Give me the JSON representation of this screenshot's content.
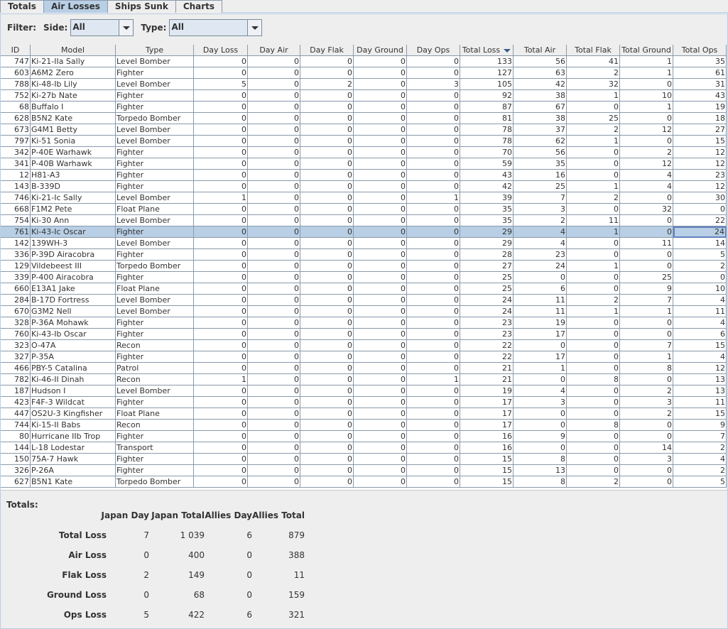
{
  "tabs": [
    "Totals",
    "Air Losses",
    "Ships Sunk",
    "Charts"
  ],
  "active_tab": 1,
  "filter": {
    "label": "Filter:",
    "side_label": "Side:",
    "side_value": "All",
    "type_label": "Type:",
    "type_value": "All"
  },
  "table": {
    "columns": [
      "ID",
      "Model",
      "Type",
      "Day Loss",
      "Day Air",
      "Day Flak",
      "Day Ground",
      "Day Ops",
      "Total Loss",
      "Total Air",
      "Total Flak",
      "Total Ground",
      "Total Ops"
    ],
    "sort_column": "Total Loss",
    "sort_direction": "descending",
    "selected_row": 15,
    "rows": [
      [
        "747",
        "Ki-21-IIa Sally",
        "Level Bomber",
        "0",
        "0",
        "0",
        "0",
        "0",
        "133",
        "56",
        "41",
        "1",
        "35"
      ],
      [
        "603",
        "A6M2 Zero",
        "Fighter",
        "0",
        "0",
        "0",
        "0",
        "0",
        "127",
        "63",
        "2",
        "1",
        "61"
      ],
      [
        "788",
        "Ki-48-Ib Lily",
        "Level Bomber",
        "5",
        "0",
        "2",
        "0",
        "3",
        "105",
        "42",
        "32",
        "0",
        "31"
      ],
      [
        "752",
        "Ki-27b Nate",
        "Fighter",
        "0",
        "0",
        "0",
        "0",
        "0",
        "92",
        "38",
        "1",
        "10",
        "43"
      ],
      [
        "68",
        "Buffalo I",
        "Fighter",
        "0",
        "0",
        "0",
        "0",
        "0",
        "87",
        "67",
        "0",
        "1",
        "19"
      ],
      [
        "628",
        "B5N2 Kate",
        "Torpedo Bomber",
        "0",
        "0",
        "0",
        "0",
        "0",
        "81",
        "38",
        "25",
        "0",
        "18"
      ],
      [
        "673",
        "G4M1 Betty",
        "Level Bomber",
        "0",
        "0",
        "0",
        "0",
        "0",
        "78",
        "37",
        "2",
        "12",
        "27"
      ],
      [
        "797",
        "Ki-51 Sonia",
        "Level Bomber",
        "0",
        "0",
        "0",
        "0",
        "0",
        "78",
        "62",
        "1",
        "0",
        "15"
      ],
      [
        "342",
        "P-40E Warhawk",
        "Fighter",
        "0",
        "0",
        "0",
        "0",
        "0",
        "70",
        "56",
        "0",
        "2",
        "12"
      ],
      [
        "341",
        "P-40B Warhawk",
        "Fighter",
        "0",
        "0",
        "0",
        "0",
        "0",
        "59",
        "35",
        "0",
        "12",
        "12"
      ],
      [
        "12",
        "H81-A3",
        "Fighter",
        "0",
        "0",
        "0",
        "0",
        "0",
        "43",
        "16",
        "0",
        "4",
        "23"
      ],
      [
        "143",
        "B-339D",
        "Fighter",
        "0",
        "0",
        "0",
        "0",
        "0",
        "42",
        "25",
        "1",
        "4",
        "12"
      ],
      [
        "746",
        "Ki-21-Ic Sally",
        "Level Bomber",
        "1",
        "0",
        "0",
        "0",
        "1",
        "39",
        "7",
        "2",
        "0",
        "30"
      ],
      [
        "668",
        "F1M2 Pete",
        "Float Plane",
        "0",
        "0",
        "0",
        "0",
        "0",
        "35",
        "3",
        "0",
        "32",
        "0"
      ],
      [
        "754",
        "Ki-30 Ann",
        "Level Bomber",
        "0",
        "0",
        "0",
        "0",
        "0",
        "35",
        "2",
        "11",
        "0",
        "22"
      ],
      [
        "761",
        "Ki-43-Ic Oscar",
        "Fighter",
        "0",
        "0",
        "0",
        "0",
        "0",
        "29",
        "4",
        "1",
        "0",
        "24"
      ],
      [
        "142",
        "139WH-3",
        "Level Bomber",
        "0",
        "0",
        "0",
        "0",
        "0",
        "29",
        "4",
        "0",
        "11",
        "14"
      ],
      [
        "336",
        "P-39D Airacobra",
        "Fighter",
        "0",
        "0",
        "0",
        "0",
        "0",
        "28",
        "23",
        "0",
        "0",
        "5"
      ],
      [
        "129",
        "Vildebeest III",
        "Torpedo Bomber",
        "0",
        "0",
        "0",
        "0",
        "0",
        "27",
        "24",
        "1",
        "0",
        "2"
      ],
      [
        "339",
        "P-400 Airacobra",
        "Fighter",
        "0",
        "0",
        "0",
        "0",
        "0",
        "25",
        "0",
        "0",
        "25",
        "0"
      ],
      [
        "660",
        "E13A1 Jake",
        "Float Plane",
        "0",
        "0",
        "0",
        "0",
        "0",
        "25",
        "6",
        "0",
        "9",
        "10"
      ],
      [
        "284",
        "B-17D Fortress",
        "Level Bomber",
        "0",
        "0",
        "0",
        "0",
        "0",
        "24",
        "11",
        "2",
        "7",
        "4"
      ],
      [
        "670",
        "G3M2 Nell",
        "Level Bomber",
        "0",
        "0",
        "0",
        "0",
        "0",
        "24",
        "11",
        "1",
        "1",
        "11"
      ],
      [
        "328",
        "P-36A Mohawk",
        "Fighter",
        "0",
        "0",
        "0",
        "0",
        "0",
        "23",
        "19",
        "0",
        "0",
        "4"
      ],
      [
        "760",
        "Ki-43-Ib Oscar",
        "Fighter",
        "0",
        "0",
        "0",
        "0",
        "0",
        "23",
        "17",
        "0",
        "0",
        "6"
      ],
      [
        "323",
        "O-47A",
        "Recon",
        "0",
        "0",
        "0",
        "0",
        "0",
        "22",
        "0",
        "0",
        "7",
        "15"
      ],
      [
        "327",
        "P-35A",
        "Fighter",
        "0",
        "0",
        "0",
        "0",
        "0",
        "22",
        "17",
        "0",
        "1",
        "4"
      ],
      [
        "466",
        "PBY-5 Catalina",
        "Patrol",
        "0",
        "0",
        "0",
        "0",
        "0",
        "21",
        "1",
        "0",
        "8",
        "12"
      ],
      [
        "782",
        "Ki-46-II Dinah",
        "Recon",
        "1",
        "0",
        "0",
        "0",
        "1",
        "21",
        "0",
        "8",
        "0",
        "13"
      ],
      [
        "187",
        "Hudson I",
        "Level Bomber",
        "0",
        "0",
        "0",
        "0",
        "0",
        "19",
        "4",
        "0",
        "2",
        "13"
      ],
      [
        "423",
        "F4F-3 Wildcat",
        "Fighter",
        "0",
        "0",
        "0",
        "0",
        "0",
        "17",
        "3",
        "0",
        "3",
        "11"
      ],
      [
        "447",
        "OS2U-3 Kingfisher",
        "Float Plane",
        "0",
        "0",
        "0",
        "0",
        "0",
        "17",
        "0",
        "0",
        "2",
        "15"
      ],
      [
        "744",
        "Ki-15-II Babs",
        "Recon",
        "0",
        "0",
        "0",
        "0",
        "0",
        "17",
        "0",
        "8",
        "0",
        "9"
      ],
      [
        "80",
        "Hurricane IIb Trop",
        "Fighter",
        "0",
        "0",
        "0",
        "0",
        "0",
        "16",
        "9",
        "0",
        "0",
        "7"
      ],
      [
        "144",
        "L-18 Lodestar",
        "Transport",
        "0",
        "0",
        "0",
        "0",
        "0",
        "16",
        "0",
        "0",
        "14",
        "2"
      ],
      [
        "150",
        "75A-7 Hawk",
        "Fighter",
        "0",
        "0",
        "0",
        "0",
        "0",
        "15",
        "8",
        "0",
        "3",
        "4"
      ],
      [
        "326",
        "P-26A",
        "Fighter",
        "0",
        "0",
        "0",
        "0",
        "0",
        "15",
        "13",
        "0",
        "0",
        "2"
      ],
      [
        "627",
        "B5N1 Kate",
        "Torpedo Bomber",
        "0",
        "0",
        "0",
        "0",
        "0",
        "15",
        "8",
        "2",
        "0",
        "5"
      ]
    ]
  },
  "totals": {
    "title": "Totals:",
    "columns": [
      "Japan Day",
      "Japan Total",
      "Allies Day",
      "Allies Total"
    ],
    "rows": [
      {
        "label": "Total Loss",
        "values": [
          "7",
          "1 039",
          "6",
          "879"
        ]
      },
      {
        "label": "Air Loss",
        "values": [
          "0",
          "400",
          "0",
          "388"
        ]
      },
      {
        "label": "Flak Loss",
        "values": [
          "2",
          "149",
          "0",
          "11"
        ]
      },
      {
        "label": "Ground Loss",
        "values": [
          "0",
          "68",
          "0",
          "159"
        ]
      },
      {
        "label": "Ops Loss",
        "values": [
          "5",
          "422",
          "6",
          "321"
        ]
      }
    ]
  },
  "colors": {
    "selection": "#b8cfe5",
    "active_tab": "#b8cfe5",
    "grid": "#8a9aab"
  }
}
